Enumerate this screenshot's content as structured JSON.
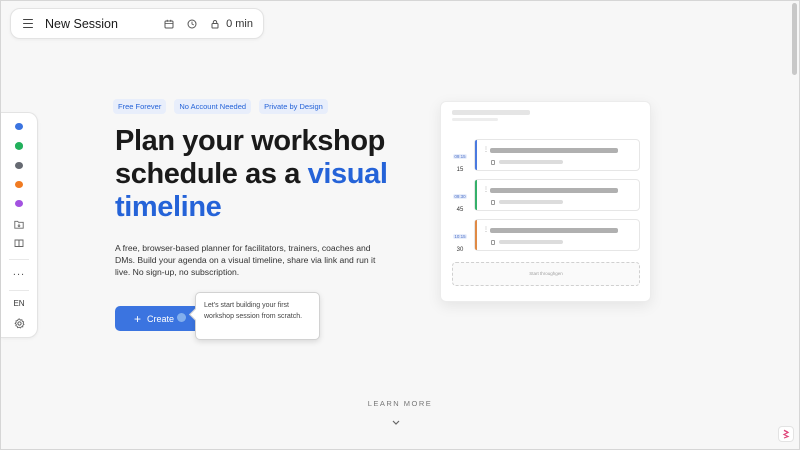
{
  "header": {
    "session_title": "New Session",
    "duration": "0 min"
  },
  "rail": {
    "colors": [
      "#3b74e0",
      "#22b05c",
      "#666a72",
      "#f07b22",
      "#a352e0"
    ],
    "more": "...",
    "language": "EN"
  },
  "hero": {
    "badges": [
      "Free Forever",
      "No Account Needed",
      "Private by Design"
    ],
    "title_part1": "Plan your workshop schedule as a ",
    "title_accent": "visual timeline",
    "description": "A free, browser-based planner for facilitators, trainers, coaches and DMs. Build your agenda on a visual timeline, share via link and run it live. No sign-up, no subscription.",
    "cta_label": "Create",
    "cta_plus": "+",
    "tooltip": "Let's start building your first workshop session from scratch."
  },
  "preview": {
    "rows": [
      {
        "time": "09:15",
        "minutes": "15",
        "color": "#4a7ae0"
      },
      {
        "time": "09:30",
        "minutes": "45",
        "color": "#35b06a"
      },
      {
        "time": "10:15",
        "minutes": "30",
        "color": "#e08a45"
      }
    ],
    "drop_label": "Start throughgen"
  },
  "footer": {
    "learn_more": "LEARN MORE"
  },
  "icons": {
    "menu": "menu-icon",
    "calendar": "calendar-icon",
    "clock": "clock-icon",
    "lock": "lock-icon",
    "import": "folder-import-icon",
    "book": "book-icon",
    "settings": "gear-icon",
    "chevron": "chevron-down-icon",
    "brand": "brand-logo-icon"
  }
}
